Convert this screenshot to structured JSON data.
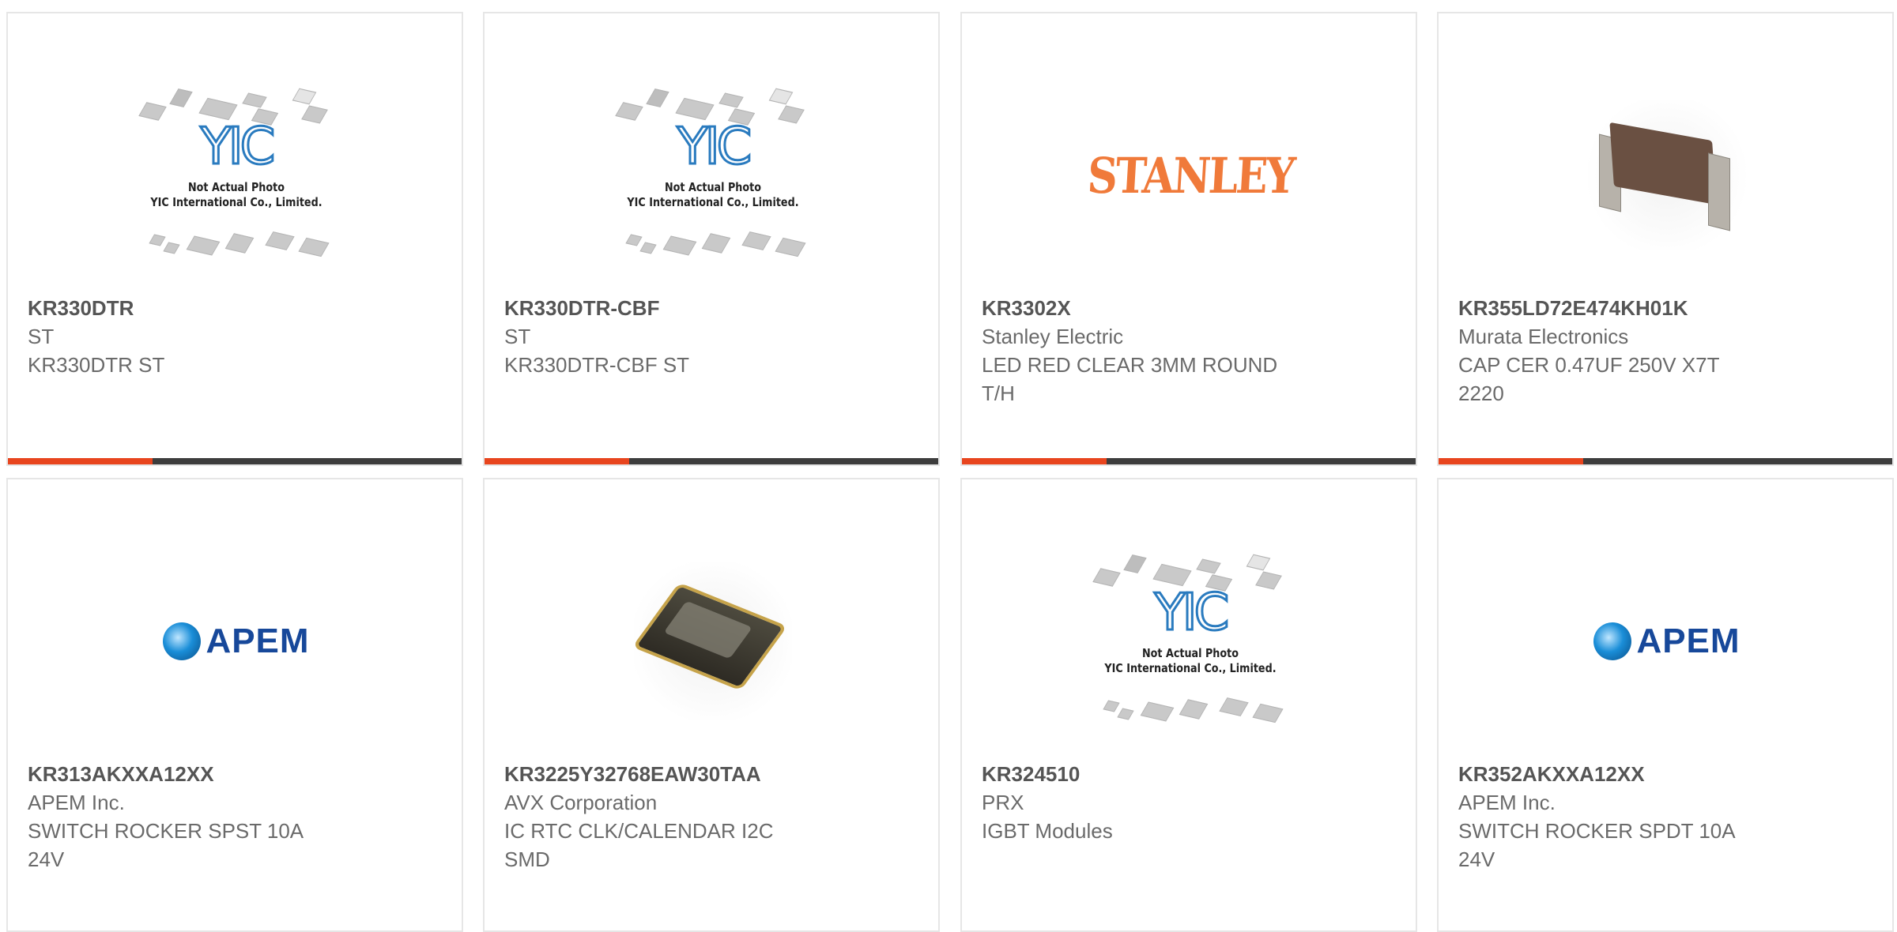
{
  "products": [
    {
      "part_number": "KR330DTR",
      "manufacturer": "ST",
      "description_lines": [
        "KR330DTR ST",
        ""
      ],
      "image": "yic-not-actual-photo",
      "image_caption": [
        "Not Actual Photo",
        "YIC International Co., Limited."
      ]
    },
    {
      "part_number": "KR330DTR-CBF",
      "manufacturer": "ST",
      "description_lines": [
        "KR330DTR-CBF ST",
        ""
      ],
      "image": "yic-not-actual-photo",
      "image_caption": [
        "Not Actual Photo",
        "YIC International Co., Limited."
      ]
    },
    {
      "part_number": "KR3302X",
      "manufacturer": "Stanley Electric",
      "description_lines": [
        "LED RED CLEAR 3MM ROUND",
        "T/H"
      ],
      "image": "stanley-logo",
      "logo_text": "STANLEY"
    },
    {
      "part_number": "KR355LD72E474KH01K",
      "manufacturer": "Murata Electronics",
      "description_lines": [
        "CAP CER 0.47UF 250V X7T",
        "2220"
      ],
      "image": "capacitor-photo"
    },
    {
      "part_number": "KR313AKXXA12XX",
      "manufacturer": "APEM Inc.",
      "description_lines": [
        "SWITCH ROCKER SPST 10A",
        "24V"
      ],
      "image": "apem-logo",
      "logo_text": "APEM"
    },
    {
      "part_number": "KR3225Y32768EAW30TAA",
      "manufacturer": "AVX Corporation",
      "description_lines": [
        "IC RTC CLK/CALENDAR I2C",
        "SMD"
      ],
      "image": "crystal-photo"
    },
    {
      "part_number": "KR324510",
      "manufacturer": "PRX",
      "description_lines": [
        "IGBT Modules",
        ""
      ],
      "image": "yic-not-actual-photo",
      "image_caption": [
        "Not Actual Photo",
        "YIC International Co., Limited."
      ]
    },
    {
      "part_number": "KR352AKXXA12XX",
      "manufacturer": "APEM Inc.",
      "description_lines": [
        "SWITCH ROCKER SPDT 10A",
        "24V"
      ],
      "image": "apem-logo",
      "logo_text": "APEM"
    }
  ],
  "yic_logo_text": "YIC",
  "colors": {
    "accent": "#e8451e",
    "bar": "#3d3d3d",
    "border": "#e6e6e6",
    "part_number": "#555555",
    "text": "#6a6a6a"
  }
}
